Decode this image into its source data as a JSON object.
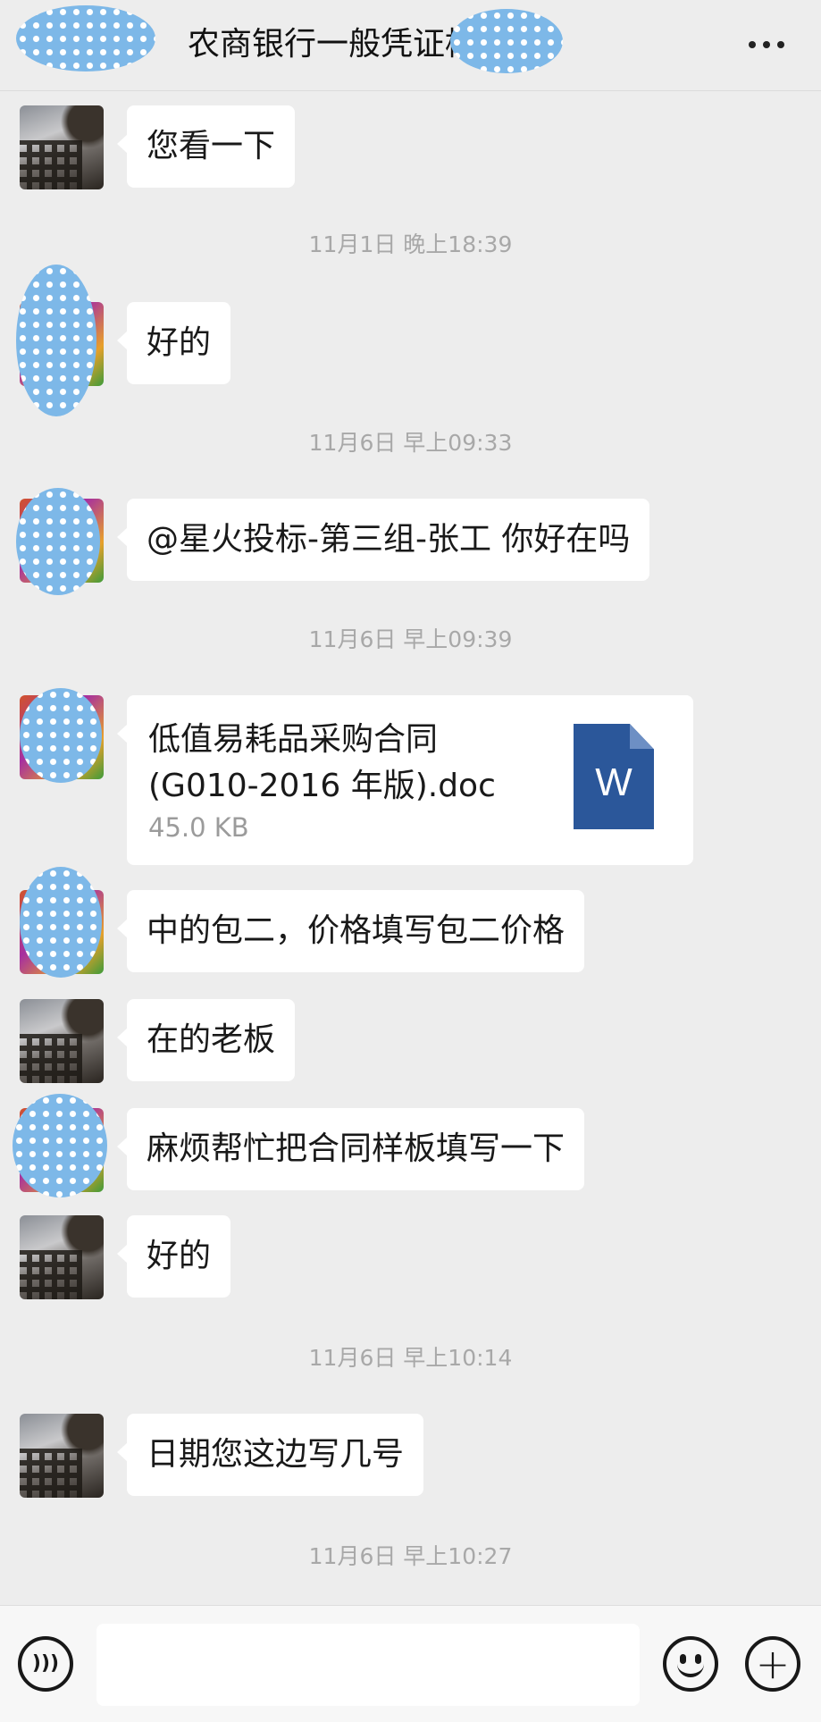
{
  "header": {
    "title": "农商银行一般凭证框架采",
    "more_icon": "more-icon"
  },
  "messages": [
    {
      "sender": "self",
      "type": "text",
      "text": "您看一下"
    },
    {
      "type": "timestamp",
      "text": "11月1日 晚上18:39"
    },
    {
      "sender": "other",
      "type": "text",
      "text": "好的"
    },
    {
      "type": "timestamp",
      "text": "11月6日 早上09:33"
    },
    {
      "sender": "other",
      "type": "text",
      "text": "@星火投标-第三组-张工  你好在吗"
    },
    {
      "type": "timestamp",
      "text": "11月6日 早上09:39"
    },
    {
      "sender": "other",
      "type": "file",
      "file_name": "低值易耗品采购合同(G010-2016 年版).doc",
      "file_size": "45.0 KB",
      "file_icon": "word-document-icon",
      "icon_letter": "W"
    },
    {
      "sender": "other",
      "type": "text",
      "text": "中的包二，价格填写包二价格"
    },
    {
      "sender": "self",
      "type": "text",
      "text": "在的老板"
    },
    {
      "sender": "other",
      "type": "text",
      "text": "麻烦帮忙把合同样板填写一下"
    },
    {
      "sender": "self",
      "type": "text",
      "text": "好的"
    },
    {
      "type": "timestamp",
      "text": "11月6日 早上10:14"
    },
    {
      "sender": "self",
      "type": "text",
      "text": "日期您这边写几号"
    },
    {
      "type": "timestamp",
      "text": "11月6日 早上10:27"
    }
  ],
  "input_bar": {
    "voice_icon": "voice-icon",
    "input_value": "",
    "emoji_icon": "emoji-icon",
    "plus_icon": "plus-icon"
  },
  "colors": {
    "background": "#ededed",
    "bubble": "#ffffff",
    "timestamp": "#a8a8a8",
    "word_blue": "#2b579a"
  }
}
